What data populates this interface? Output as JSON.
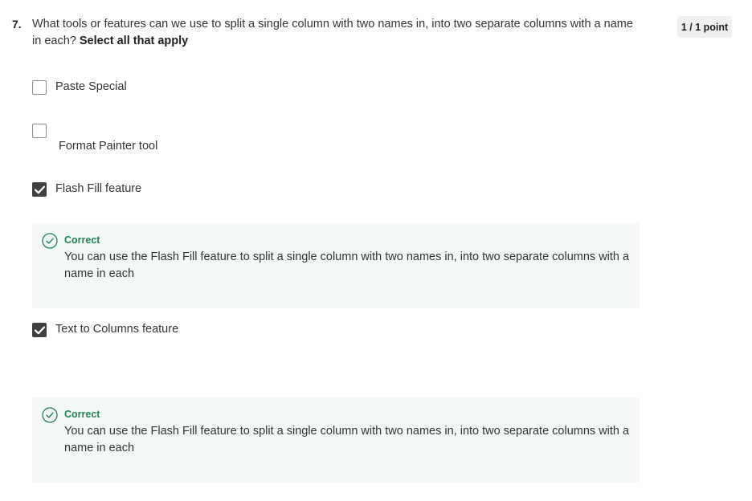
{
  "question": {
    "number": "7.",
    "text": "What tools or features can we use to split a single column with two names in, into two separate columns with a name in each?",
    "instruction": "Select all that apply"
  },
  "score": {
    "label": "1 / 1 point"
  },
  "options": [
    {
      "label": "Paste Special",
      "checked": false
    },
    {
      "label": "Format Painter tool",
      "checked": false
    },
    {
      "label": "Flash Fill feature",
      "checked": true
    },
    {
      "label": "Text to Columns feature",
      "checked": true
    }
  ],
  "feedback": [
    {
      "title": "Correct",
      "text": "You can use the Flash Fill feature to split a single column with two names in, into two separate columns with a name in each"
    },
    {
      "title": "Correct",
      "text": "You can use the Flash Fill feature to split a single column with two names in, into two separate columns with a name in each"
    }
  ],
  "colors": {
    "correct": "#1f8354",
    "feedback_bg": "#f4f8f7",
    "checkbox_checked": "#404040"
  },
  "icons": {
    "check": "checkmark-icon",
    "correct": "check-circle-icon"
  }
}
